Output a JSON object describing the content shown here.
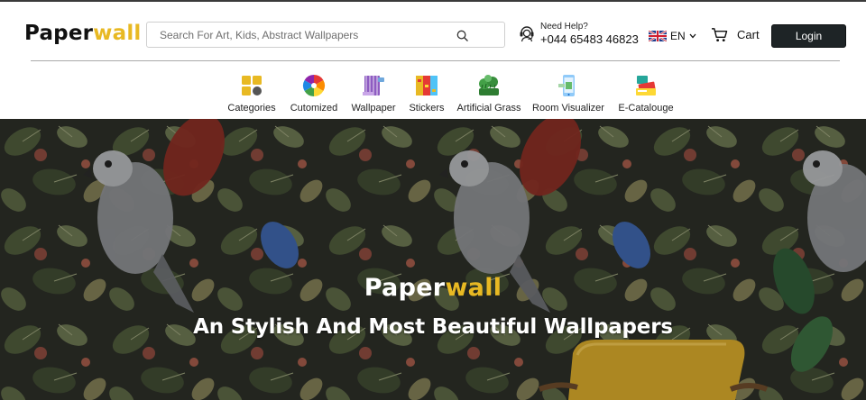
{
  "brand": {
    "part1": "Paper",
    "part2": "wall",
    "accent_color": "#e8b923"
  },
  "search": {
    "placeholder": "Search For Art, Kids, Abstract Wallpapers",
    "icon": "search-icon"
  },
  "help": {
    "title": "Need Help?",
    "phone": "+044 65483 46823",
    "icon": "headset-icon"
  },
  "language": {
    "code": "EN",
    "icon": "uk-flag-icon"
  },
  "cart": {
    "label": "Cart",
    "icon": "cart-icon"
  },
  "login": {
    "label": "Login",
    "color": "#1e2426"
  },
  "nav": {
    "items": [
      {
        "label": "Categories",
        "icon": "categories-icon"
      },
      {
        "label": "Cutomized",
        "icon": "color-wheel-icon"
      },
      {
        "label": "Wallpaper",
        "icon": "wallpaper-roll-icon"
      },
      {
        "label": "Stickers",
        "icon": "stickers-icon"
      },
      {
        "label": "Artificial Grass",
        "icon": "artificial-grass-icon"
      },
      {
        "label": "Room Visualizer",
        "icon": "room-visualizer-icon"
      },
      {
        "label": "E-Catalouge",
        "icon": "e-catalogue-icon"
      }
    ]
  },
  "hero": {
    "brand_part1": "Paper",
    "brand_part2": "wall",
    "subtitle": "An Stylish And Most Beautiful Wallpapers"
  }
}
